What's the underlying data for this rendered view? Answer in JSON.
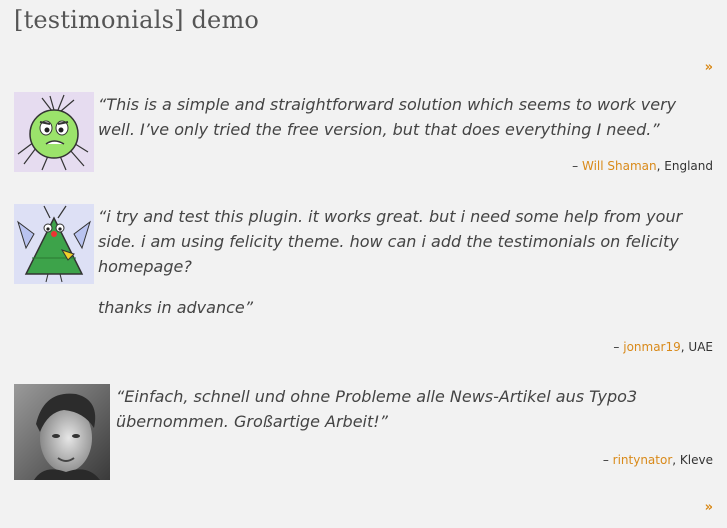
{
  "page": {
    "title": "[testimonials] demo",
    "next_label": "»"
  },
  "colors": {
    "link": "#d98a1a",
    "background": "#f2f2f2",
    "text": "#444444"
  },
  "testimonials": [
    {
      "avatar": "green-bug-cartoon",
      "quote": "“This is a simple and straightforward solution which seems to work very well. I’ve only tried the free version, but that does everything I need.”",
      "dash": "–",
      "author": "Will Shaman",
      "location_sep": ",",
      "location": "England"
    },
    {
      "avatar": "tree-bug-cartoon",
      "quote": "“i try and test this plugin. it works great. but i need some help from your side. i am using felicity theme. how can i add the testimonials on felicity homepage?",
      "quote_p2": "thanks in advance”",
      "dash": "–",
      "author": "jonmar19",
      "location_sep": ",",
      "location": "UAE"
    },
    {
      "avatar": "person-photo",
      "quote": "“Einfach, schnell und ohne Probleme alle News-Artikel aus Typo3 übernommen. Großartige Arbeit!”",
      "dash": "–",
      "author": "rintynator",
      "location_sep": ",",
      "location": "Kleve"
    }
  ]
}
